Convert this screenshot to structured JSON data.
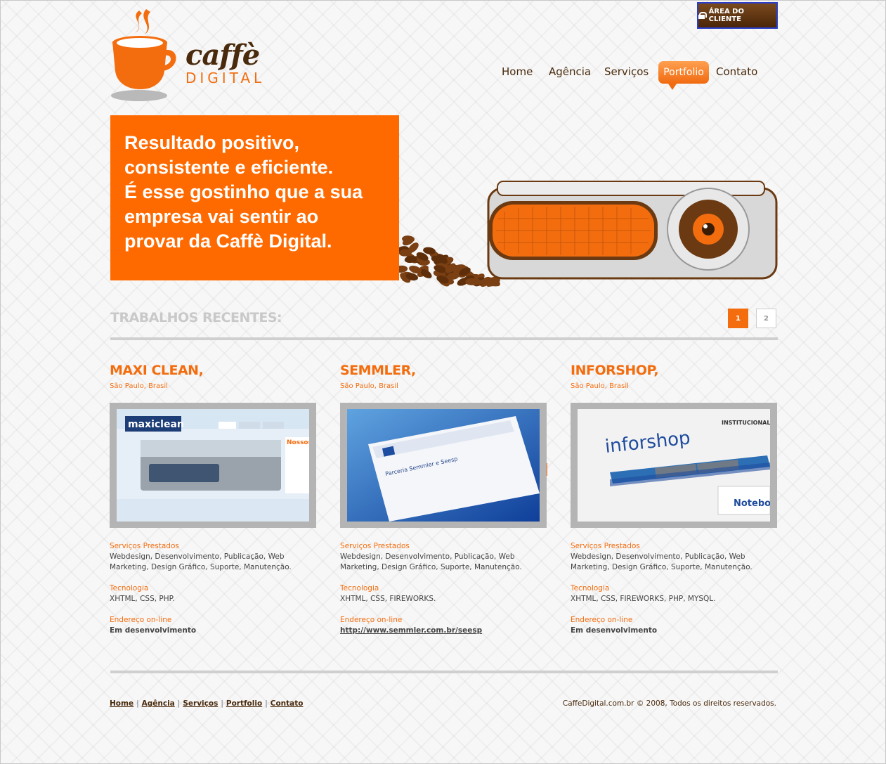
{
  "header": {
    "client_area": "ÁREA DO CLIENTE",
    "logo_top": "caffè",
    "logo_bottom": "DIGITAL"
  },
  "nav": {
    "home": "Home",
    "agencia": "Agência",
    "servicos": "Serviços",
    "portfolio": "Portfolio",
    "contato": "Contato"
  },
  "hero": {
    "lines": [
      "Resultado positivo,",
      "consistente e eficiente.",
      "É esse gostinho que a sua",
      "empresa vai sentir ao",
      "provar da Caffè Digital."
    ]
  },
  "recent": {
    "title": "TRABALHOS RECENTES:",
    "pages": [
      "1",
      "2"
    ]
  },
  "labels": {
    "services": "Serviços Prestados",
    "tech": "Tecnologia",
    "address": "Endereço on-line"
  },
  "projects": [
    {
      "title": "MAXI CLEAN,",
      "location": "São Paulo, Brasil",
      "services": "Webdesign, Desenvolvimento, Publicação, Web Marketing, Design Gráfico, Suporte, Manutenção.",
      "tech": "XHTML, CSS, PHP.",
      "url": "Em desenvolvimento",
      "thumb_text": "maxiclean"
    },
    {
      "title": "SEMMLER,",
      "location": "São Paulo, Brasil",
      "services": "Webdesign, Desenvolvimento, Publicação, Web Marketing, Design Gráfico, Suporte, Manutenção.",
      "tech": "XHTML, CSS, FIREWORKS.",
      "url": "http://www.semmler.com.br/seesp",
      "thumb_text": "Parceria Semmler e Seesp"
    },
    {
      "title": "INFORSHOP,",
      "location": "São Paulo, Brasil",
      "services": "Webdesign, Desenvolvimento, Publicação, Web Marketing, Design Gráfico, Suporte, Manutenção.",
      "tech": "XHTML, CSS, FIREWORKS, PHP, MYSQL.",
      "url": "Em desenvolvimento",
      "thumb_text": "inforshop"
    }
  ],
  "footer": {
    "links": [
      "Home",
      "Agência",
      "Serviços",
      "Portfolio",
      "Contato"
    ],
    "copyright": "CaffeDigital.com.br © 2008, Todos os direitos reservados."
  },
  "colors": {
    "accent": "#f36d0f",
    "brown": "#4a2a0c",
    "hero_bg": "#ff6a00"
  }
}
